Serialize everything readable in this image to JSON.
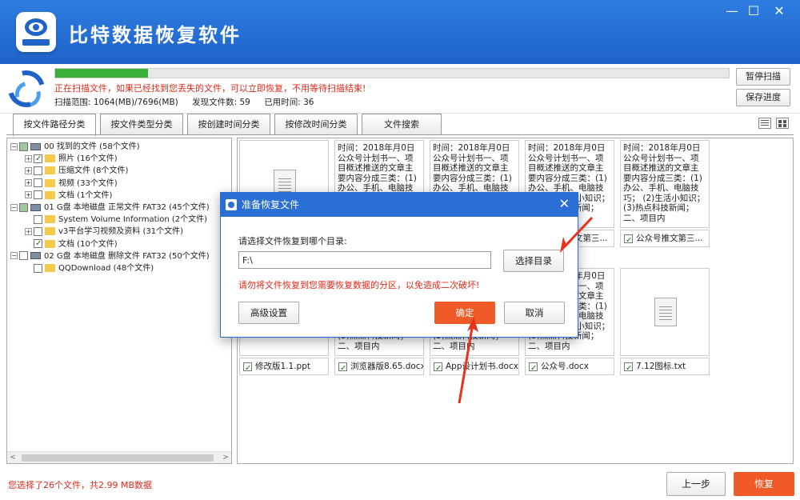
{
  "app": {
    "title": "比特数据恢复软件",
    "window": {
      "minimize": "—",
      "maximize": "☐",
      "close": "✕"
    }
  },
  "scan": {
    "progress_percent": 13.8,
    "message": "正在扫描文件，如果已经找到您丢失的文件，可以立即恢复，不用等待扫描结束!",
    "range_label": "扫描范围: 1064(MB)/7696(MB)",
    "found_label": "发现文件数: 59",
    "time_label": "已用时间: 36",
    "pause_button": "暂停扫描",
    "save_button": "保存进度"
  },
  "tabs": [
    "按文件路径分类",
    "按文件类型分类",
    "按创建时间分类",
    "按修改时间分类",
    "文件搜索"
  ],
  "tree": [
    {
      "label": "00 找到的文件  (58个文件)",
      "level": 0,
      "expander": "−",
      "check": "part",
      "icon": "drive"
    },
    {
      "label": "照片    (16个文件)",
      "level": 1,
      "expander": "+",
      "check": "on",
      "icon": "folder"
    },
    {
      "label": "压缩文件   (8个文件)",
      "level": 1,
      "expander": "+",
      "check": "off",
      "icon": "folder"
    },
    {
      "label": "视频    (33个文件)",
      "level": 1,
      "expander": "+",
      "check": "off",
      "icon": "folder"
    },
    {
      "label": "文档    (1个文件)",
      "level": 1,
      "expander": "+",
      "check": "off",
      "icon": "folder"
    },
    {
      "label": "01 G盘 本地磁盘 正常文件 FAT32  (45个文件)",
      "level": 0,
      "expander": "−",
      "check": "part",
      "icon": "drive"
    },
    {
      "label": "System Volume Information    (2个文件)",
      "level": 1,
      "expander": "",
      "check": "off",
      "icon": "folder"
    },
    {
      "label": "v3平台学习视频及资料    (31个文件)",
      "level": 1,
      "expander": "+",
      "check": "off",
      "icon": "folder"
    },
    {
      "label": "文档    (10个文件)",
      "level": 1,
      "expander": "",
      "check": "on",
      "icon": "folder"
    },
    {
      "label": "02 G盘 本地磁盘 删除文件 FAT32  (50个文件)",
      "level": 0,
      "expander": "−",
      "check": "off",
      "icon": "drive"
    },
    {
      "label": "QQDownload    (48个文件)",
      "level": 1,
      "expander": "",
      "check": "off",
      "icon": "folder"
    }
  ],
  "preview_text": "时间：2018年月0日公众号计划书一、项目概述推送的文章主要内容分成三类：(1)办公、手机、电脑技巧；  (2)生活小知识；  (3)热点科技新闻；二、项目内",
  "files_row1": [
    {
      "caption": "",
      "type": "icon"
    },
    {
      "caption": "",
      "type": "text"
    },
    {
      "caption": "",
      "type": "text"
    },
    {
      "caption": "公众号推文第三...",
      "type": "text"
    },
    {
      "caption": "公众号推文第三...",
      "type": "text"
    }
  ],
  "files_row2": [
    {
      "caption": "修改版1.1.ppt",
      "type": "icon"
    },
    {
      "caption": "浏览器版8.65.docx",
      "type": "text"
    },
    {
      "caption": "App设计划书.docx",
      "type": "text"
    },
    {
      "caption": "公众号.docx",
      "type": "text"
    },
    {
      "caption": "7.12图标.txt",
      "type": "icon"
    }
  ],
  "status": {
    "selected_text": "您选择了26个文件，共2.99 MB数据"
  },
  "bottom": {
    "prev_button": "上一步",
    "recover_button": "恢复"
  },
  "dialog": {
    "title": "准备恢复文件",
    "close": "✕",
    "prompt": "请选择文件恢复到哪个目录:",
    "path_value": "F:\\",
    "browse_button": "选择目录",
    "warning": "请勿将文件恢复到您需要恢复数据的分区，以免造成二次破坏!",
    "advanced_button": "高级设置",
    "ok_button": "确定",
    "cancel_button": "取消"
  },
  "colors": {
    "brand_blue": "#1f63c9",
    "accent_orange": "#f05a28",
    "warning_red": "#e02a1a",
    "progress_green": "#3ab03a",
    "annotation_red": "#e8321e"
  }
}
